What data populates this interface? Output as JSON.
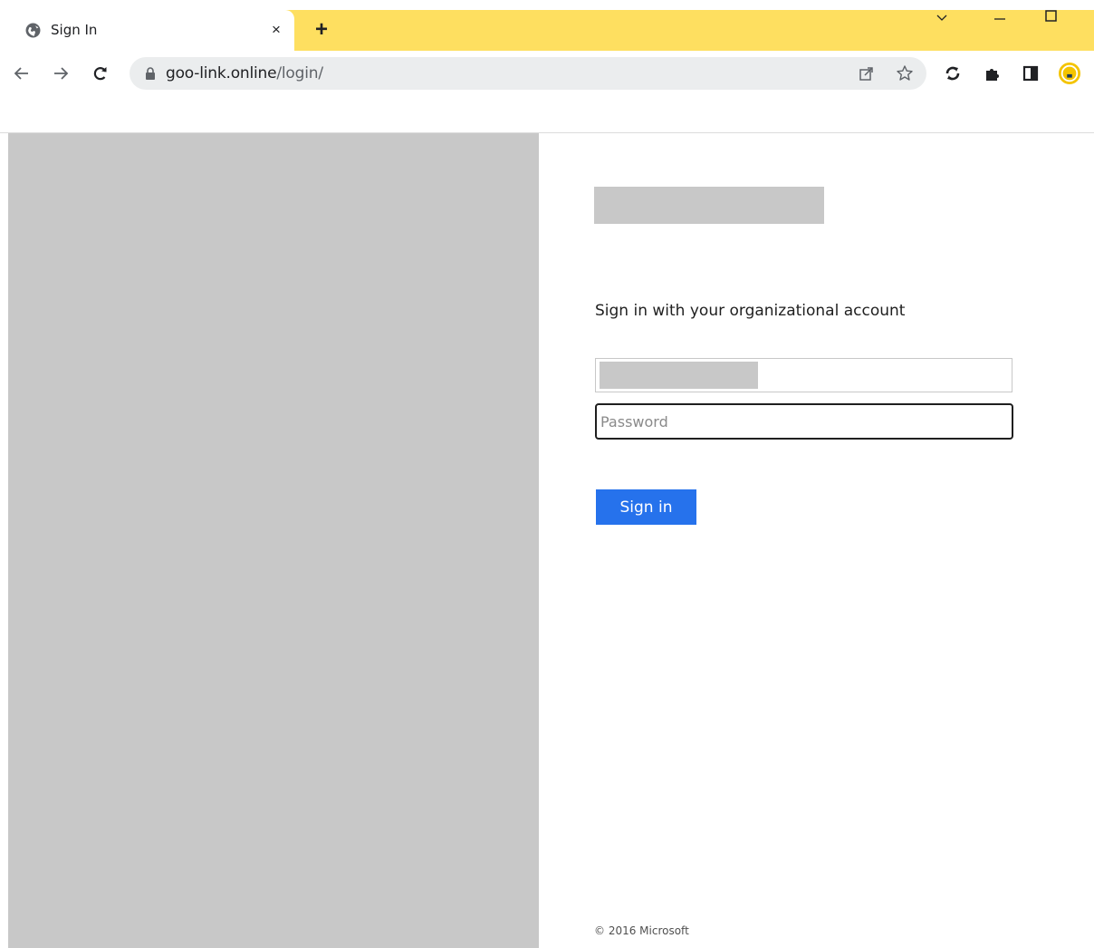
{
  "browser": {
    "tab": {
      "title": "Sign In",
      "favicon": "globe-icon",
      "close_label": "×"
    },
    "new_tab_label": "+",
    "window_controls": [
      "chevron-down-icon",
      "minimize-icon",
      "maximize-icon"
    ],
    "nav": [
      "back-icon",
      "forward-icon",
      "reload-icon"
    ],
    "omnibox": {
      "lock_icon": "lock-icon",
      "host": "goo-link.online",
      "path": "/login/",
      "actions": [
        "share-icon",
        "bookmark-star-icon"
      ]
    },
    "extensions": [
      "sync-extension-icon",
      "puzzle-extensions-icon",
      "side-panel-icon",
      "profile-avatar-icon"
    ],
    "colors": {
      "tabstrip": "#fedf60",
      "omnibox": "#ebedee",
      "profile_ring": "#f4c400"
    }
  },
  "page": {
    "prompt": "Sign in with your organizational account",
    "password_placeholder": "Password",
    "signin_label": "Sign in",
    "footer": "© 2016 Microsoft",
    "colors": {
      "placeholder_block": "#c8c8c8",
      "signin_button": "#2672ec"
    }
  }
}
